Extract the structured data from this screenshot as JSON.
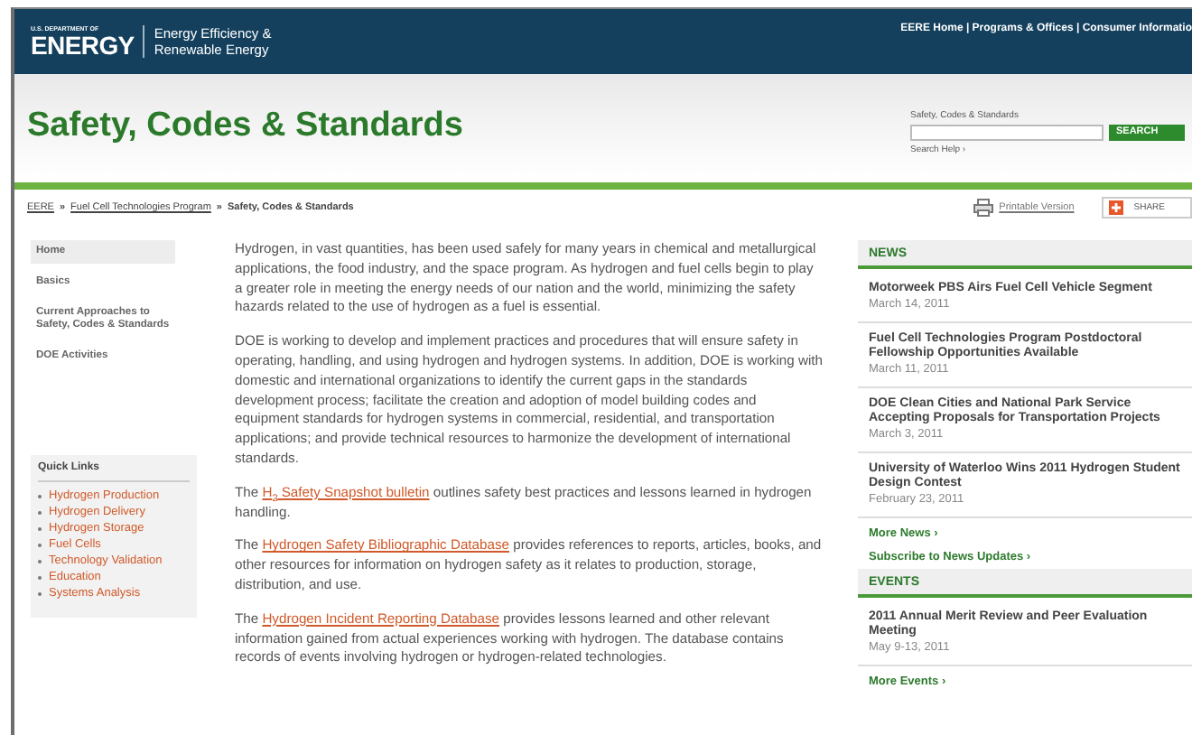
{
  "header": {
    "agency": "U.S. DEPARTMENT OF",
    "logo": "ENERGY",
    "office": [
      "Energy Efficiency &",
      "Renewable Energy"
    ],
    "top_links": "EERE Home | Programs & Offices | Consumer Informatio"
  },
  "title": "Safety, Codes & Standards",
  "search": {
    "label": "Safety, Codes & Standards",
    "button": "SEARCH",
    "help": "Search Help ›"
  },
  "breadcrumb": [
    {
      "text": "EERE",
      "link": true
    },
    {
      "text": "»",
      "link": false
    },
    {
      "text": "Fuel Cell Technologies Program",
      "link": true
    },
    {
      "text": "»",
      "link": false
    },
    {
      "text": "Safety, Codes & Standards",
      "link": false
    }
  ],
  "tools": {
    "print": "Printable Version",
    "share": "SHARE"
  },
  "sidebar": {
    "items": [
      {
        "label": "Home",
        "selected": true
      },
      {
        "label": "Basics",
        "selected": false
      },
      {
        "label": "Current Approaches to Safety, Codes & Standards",
        "selected": false
      },
      {
        "label": "DOE Activities",
        "selected": false
      }
    ],
    "quick_links": {
      "title": "Quick Links",
      "items": [
        "Hydrogen Production",
        "Hydrogen Delivery",
        "Hydrogen Storage",
        "Fuel Cells",
        "Technology Validation",
        "Education",
        "Systems Analysis"
      ]
    }
  },
  "paragraphs": [
    {
      "text": "Hydrogen, in vast quantities, has been used safely for many years in chemical and metallurgical applications, the food industry, and the space program. As hydrogen and fuel cells begin to play a greater role in meeting the energy needs of our nation and the world, minimizing the safety hazards related to the use of hydrogen as a fuel is essential."
    },
    {
      "text": "DOE is working to develop and implement practices and procedures that will ensure safety in operating, handling, and using hydrogen and hydrogen systems. In addition, DOE is working with domestic and international organizations to identify the current gaps in the standards development process; facilitate the creation and adoption of model building codes and equipment standards for hydrogen systems in commercial, residential, and transportation applications; and provide technical resources to harmonize the development of international standards."
    },
    {
      "before": "The ",
      "link": "H$_{2}$ Safety Snapshot bulletin",
      "text": " outlines safety best practices and lessons learned in hydrogen handling."
    },
    {
      "before": "The ",
      "link": "Hydrogen Safety Bibliographic Database",
      "text": " provides references to reports, articles, books, and other resources for information on hydrogen safety as it relates to production, storage, distribution, and use."
    },
    {
      "before": "The ",
      "link": "Hydrogen Incident Reporting Database",
      "text": " provides lessons learned and other relevant information gained from actual experiences working with hydrogen. The database contains records of events involving hydrogen or hydrogen-related technologies."
    }
  ],
  "news": {
    "title": "NEWS",
    "items": [
      {
        "headline": "Motorweek PBS Airs Fuel Cell Vehicle Segment",
        "date": "March 14, 2011"
      },
      {
        "headline": "Fuel Cell Technologies Program Postdoctoral Fellowship Opportunities Available",
        "date": "March 11, 2011"
      },
      {
        "headline": "DOE Clean Cities and National Park Service Accepting Proposals for Transportation Projects",
        "date": "March 3, 2011"
      },
      {
        "headline": "University of Waterloo Wins 2011 Hydrogen Student Design Contest",
        "date": "February 23, 2011"
      }
    ],
    "links": [
      "More News ›",
      "Subscribe to News Updates ›"
    ]
  },
  "events": {
    "title": "EVENTS",
    "items": [
      {
        "headline": "2011 Annual Merit Review and Peer Evaluation Meeting",
        "date": "May 9-13, 2011"
      }
    ],
    "links": [
      "More Events ›"
    ]
  }
}
